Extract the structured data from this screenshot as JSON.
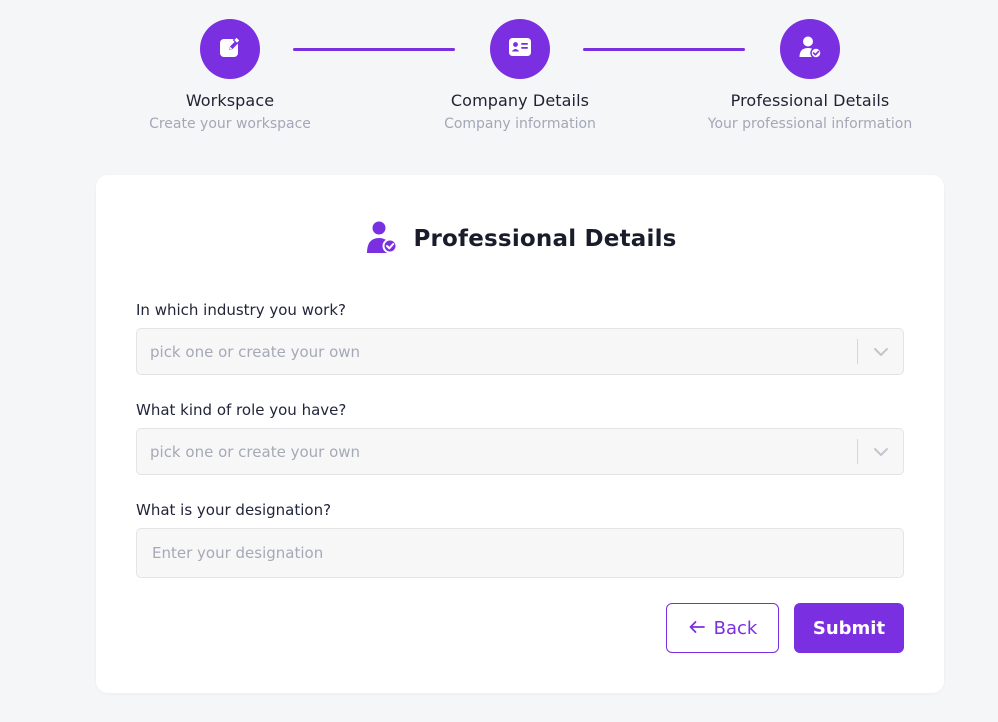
{
  "colors": {
    "accent": "#7a2fe0",
    "background": "#f5f6f8",
    "muted": "#a3a7b7"
  },
  "stepper": {
    "steps": [
      {
        "icon": "edit-icon",
        "title": "Workspace",
        "subtitle": "Create your workspace"
      },
      {
        "icon": "id-card-icon",
        "title": "Company Details",
        "subtitle": "Company information"
      },
      {
        "icon": "user-check-icon",
        "title": "Professional Details",
        "subtitle": "Your professional information"
      }
    ]
  },
  "card": {
    "icon": "user-check-icon",
    "title": "Professional Details",
    "fields": {
      "industry": {
        "label": "In which industry you work?",
        "placeholder": "pick one or create your own"
      },
      "role": {
        "label": "What kind of role you have?",
        "placeholder": "pick one or create your own"
      },
      "designation": {
        "label": "What is your designation?",
        "placeholder": "Enter your designation",
        "value": ""
      }
    },
    "buttons": {
      "back": "Back",
      "submit": "Submit"
    }
  }
}
